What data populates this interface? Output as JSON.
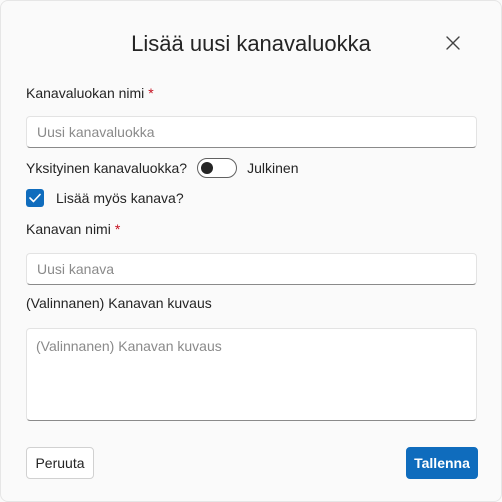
{
  "dialog": {
    "title": "Lisää uusi kanavaluokka",
    "close_icon": "close-icon"
  },
  "category_name": {
    "label": "Kanavaluokan nimi",
    "required_mark": "*",
    "value": "",
    "placeholder": "Uusi kanavaluokka"
  },
  "privacy_toggle": {
    "label": "Yksityinen kanavaluokka?",
    "state_label": "Julkinen",
    "on": false
  },
  "add_channel": {
    "label": "Lisää myös kanava?",
    "checked": true,
    "check_icon": "checkmark-icon"
  },
  "channel_name": {
    "label": "Kanavan nimi",
    "required_mark": "*",
    "value": "",
    "placeholder": "Uusi kanava"
  },
  "channel_description": {
    "label": "(Valinnanen) Kanavan kuvaus",
    "value": "",
    "placeholder": "(Valinnanen) Kanavan kuvaus"
  },
  "actions": {
    "cancel_label": "Peruuta",
    "save_label": "Tallenna"
  },
  "colors": {
    "accent": "#0f6cbd",
    "required": "#c50f1f",
    "background": "#fafafa",
    "text": "#242424",
    "placeholder": "#8a8a8a"
  }
}
